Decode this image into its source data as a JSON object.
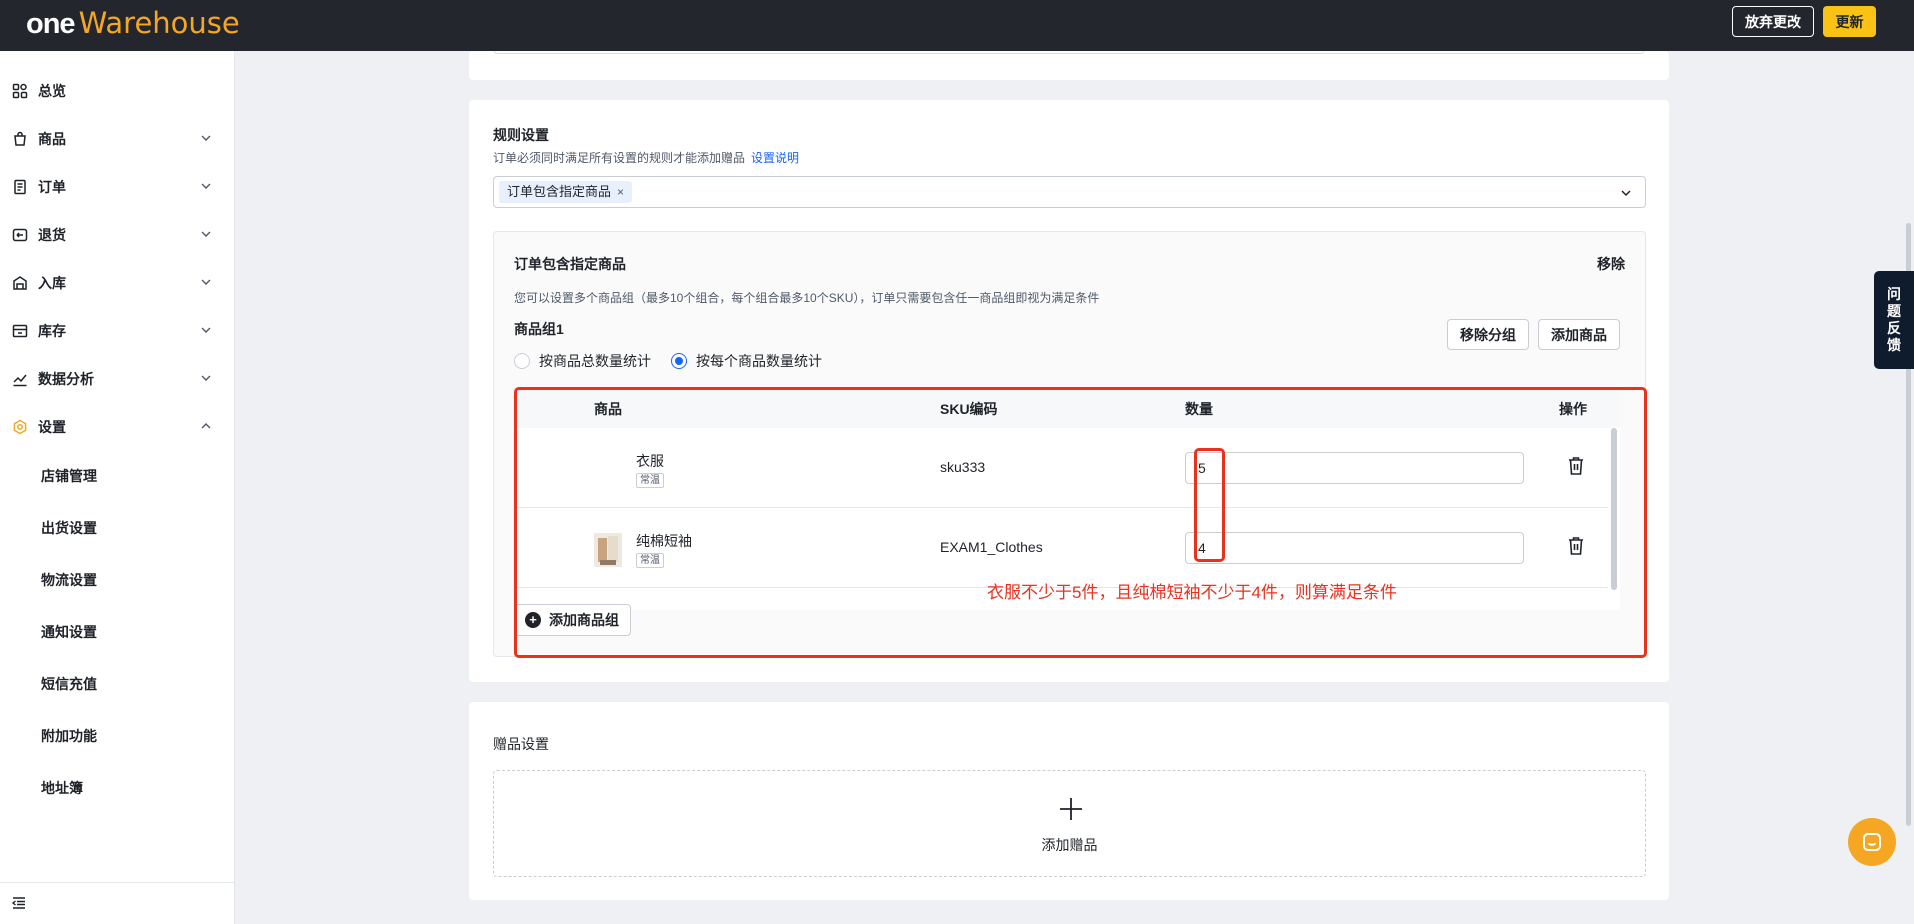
{
  "header": {
    "logo_one": "one",
    "logo_warehouse": "Warehouse",
    "discard_label": "放弃更改",
    "update_label": "更新"
  },
  "sidebar": {
    "items": [
      {
        "label": "总览",
        "icon": "dashboard-icon"
      },
      {
        "label": "商品",
        "icon": "bag-icon"
      },
      {
        "label": "订单",
        "icon": "order-icon"
      },
      {
        "label": "退货",
        "icon": "return-icon"
      },
      {
        "label": "入库",
        "icon": "inbound-icon"
      },
      {
        "label": "库存",
        "icon": "inventory-icon"
      },
      {
        "label": "数据分析",
        "icon": "chart-icon"
      },
      {
        "label": "设置",
        "icon": "gear-icon"
      }
    ],
    "sub_items": [
      "店铺管理",
      "出货设置",
      "物流设置",
      "通知设置",
      "短信充值",
      "附加功能",
      "地址簿"
    ]
  },
  "rules": {
    "title": "规则设置",
    "desc": "订单必须同时满足所有设置的规则才能添加赠品",
    "link": "设置说明",
    "tag": "订单包含指定商品",
    "rule_title": "订单包含指定商品",
    "remove_label": "移除",
    "rule_desc": "您可以设置多个商品组（最多10个组合，每个组合最多10个SKU），订单只需要包含任一商品组即视为满足条件",
    "group_title": "商品组1",
    "remove_group_label": "移除分组",
    "add_product_label": "添加商品",
    "radio_total": "按商品总数量统计",
    "radio_each": "按每个商品数量统计",
    "table": {
      "headers": {
        "product": "商品",
        "sku": "SKU编码",
        "qty": "数量",
        "action": "操作"
      },
      "rows": [
        {
          "name": "衣服",
          "tag": "常温",
          "sku": "sku333",
          "qty": "5"
        },
        {
          "name": "纯棉短袖",
          "tag": "常温",
          "sku": "EXAM1_Clothes",
          "qty": "4"
        }
      ]
    },
    "add_group_label": "添加商品组"
  },
  "annotation": {
    "text": "衣服不少于5件，且纯棉短袖不少于4件，则算满足条件",
    "color": "#e8321e"
  },
  "gift": {
    "title": "赠品设置",
    "add_label": "添加赠品"
  },
  "feedback": {
    "chars": [
      "问",
      "题",
      "反",
      "馈"
    ]
  },
  "colors": {
    "accent": "#fbc216",
    "brand_orange": "#f5a623",
    "link": "#1664ff",
    "topbar": "#23262d"
  }
}
